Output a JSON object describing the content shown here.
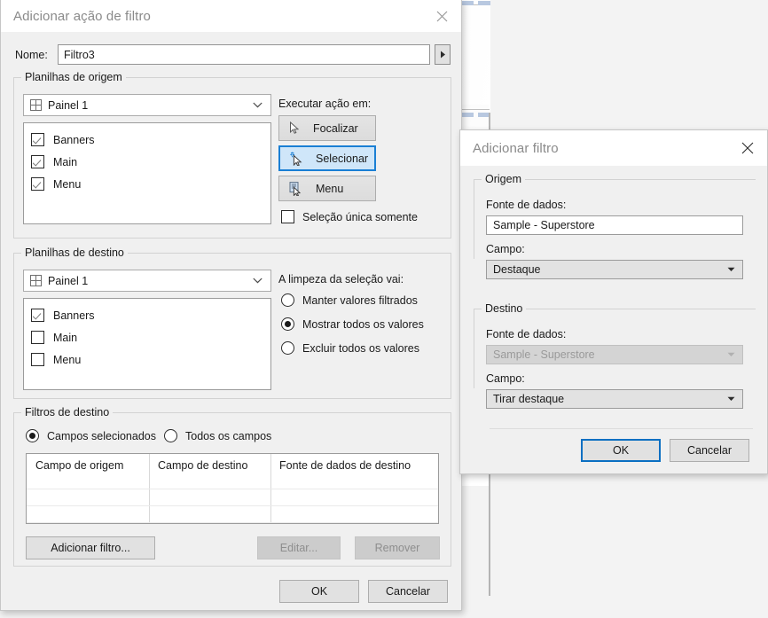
{
  "background": {
    "note": "document canvas visible behind dialogs"
  },
  "filter_action_dialog": {
    "title": "Adicionar ação de filtro",
    "close_icon": "close-icon",
    "name": {
      "label": "Nome:",
      "value": "Filtro3",
      "dropdown_icon": "triangle-right-icon"
    },
    "source_sheets": {
      "legend": "Planilhas de origem",
      "dashboard": {
        "icon": "dashboard-grid-icon",
        "value": "Painel 1",
        "chevron_icon": "chevron-down-icon"
      },
      "sheets": [
        {
          "label": "Banners",
          "checked": true
        },
        {
          "label": "Main",
          "checked": true
        },
        {
          "label": "Menu",
          "checked": true
        }
      ],
      "run_action_label": "Executar ação em:",
      "actions": [
        {
          "label": "Focalizar",
          "icon": "hover-cursor-icon",
          "selected": false
        },
        {
          "label": "Selecionar",
          "icon": "select-cursor-icon",
          "selected": true
        },
        {
          "label": "Menu",
          "icon": "menu-cursor-icon",
          "selected": false
        }
      ],
      "single_select": {
        "label": "Seleção única somente",
        "checked": false
      }
    },
    "target_sheets": {
      "legend": "Planilhas de destino",
      "dashboard": {
        "icon": "dashboard-grid-icon",
        "value": "Painel 1",
        "chevron_icon": "chevron-down-icon"
      },
      "sheets": [
        {
          "label": "Banners",
          "checked": true
        },
        {
          "label": "Main",
          "checked": false
        },
        {
          "label": "Menu",
          "checked": false
        }
      ],
      "clearing_label": "A limpeza da seleção vai:",
      "clearing_options": [
        {
          "label": "Manter valores filtrados",
          "selected": false
        },
        {
          "label": "Mostrar todos os valores",
          "selected": true
        },
        {
          "label": "Excluir todos os valores",
          "selected": false
        }
      ]
    },
    "target_filters": {
      "legend": "Filtros de destino",
      "scope_options": [
        {
          "label": "Campos selecionados",
          "selected": true
        },
        {
          "label": "Todos os campos",
          "selected": false
        }
      ],
      "columns": [
        "Campo de origem",
        "Campo de destino",
        "Fonte de dados de destino"
      ],
      "rows": [],
      "add_filter_button": "Adicionar filtro...",
      "edit_button": "Editar...",
      "remove_button": "Remover"
    },
    "ok_button": "OK",
    "cancel_button": "Cancelar"
  },
  "add_filter_dialog": {
    "title": "Adicionar filtro",
    "close_icon": "close-icon",
    "source": {
      "legend": "Origem",
      "datasource_label": "Fonte de dados:",
      "datasource_value": "Sample - Superstore",
      "field_label": "Campo:",
      "field_value": "Destaque",
      "field_chevron_icon": "caret-down-icon"
    },
    "target": {
      "legend": "Destino",
      "datasource_label": "Fonte de dados:",
      "datasource_value": "Sample - Superstore",
      "datasource_disabled": true,
      "field_label": "Campo:",
      "field_value": "Tirar destaque",
      "field_chevron_icon": "caret-down-icon"
    },
    "ok_button": "OK",
    "cancel_button": "Cancelar"
  },
  "colors": {
    "accent": "#0a6fc2",
    "selected_button_bg": "#cfe6f9",
    "dialog_bg": "#f0f0f0",
    "titlebar_bg": "#ffffff"
  }
}
